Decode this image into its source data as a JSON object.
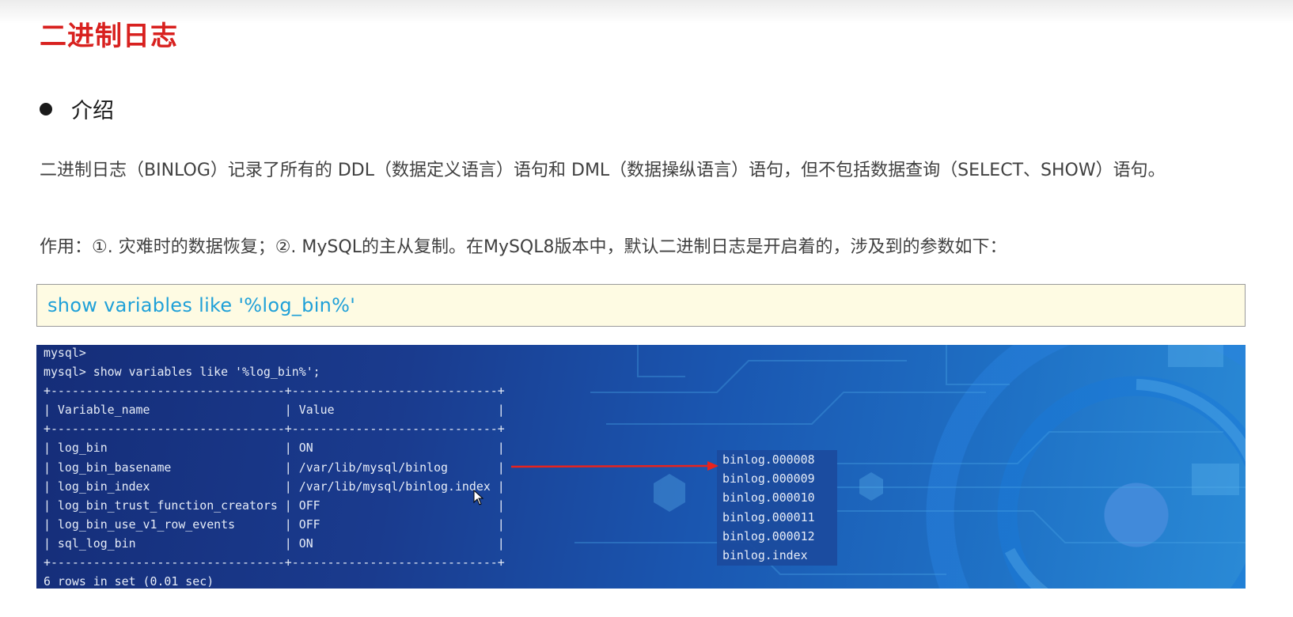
{
  "heading": "二进制日志",
  "section": {
    "label": "介绍"
  },
  "paragraphs": [
    "二进制日志（BINLOG）记录了所有的 DDL（数据定义语言）语句和 DML（数据操纵语言）语句，但不包括数据查询（SELECT、SHOW）语句。",
    "作用：①. 灾难时的数据恢复；②. MySQL的主从复制。在MySQL8版本中，默认二进制日志是开启着的，涉及到的参数如下："
  ],
  "code": "show variables like '%log_bin%'",
  "terminal": {
    "lines": [
      "mysql>",
      "mysql> show variables like '%log_bin%';",
      "+---------------------------------+-----------------------------+",
      "| Variable_name                   | Value                       |",
      "+---------------------------------+-----------------------------+",
      "| log_bin                         | ON                          |",
      "| log_bin_basename                | /var/lib/mysql/binlog       |",
      "| log_bin_index                   | /var/lib/mysql/binlog.index |",
      "| log_bin_trust_function_creators | OFF                         |",
      "| log_bin_use_v1_row_events       | OFF                         |",
      "| sql_log_bin                     | ON                          |",
      "+---------------------------------+-----------------------------+",
      "6 rows in set (0.01 sec)"
    ]
  },
  "binlog_files": [
    "binlog.000008",
    "binlog.000009",
    "binlog.000010",
    "binlog.000011",
    "binlog.000012",
    "binlog.index"
  ],
  "colors": {
    "heading": "#d8211f",
    "code_text": "#1fa0d8",
    "code_background": "#fefbe3",
    "arrow": "#e8231d"
  }
}
